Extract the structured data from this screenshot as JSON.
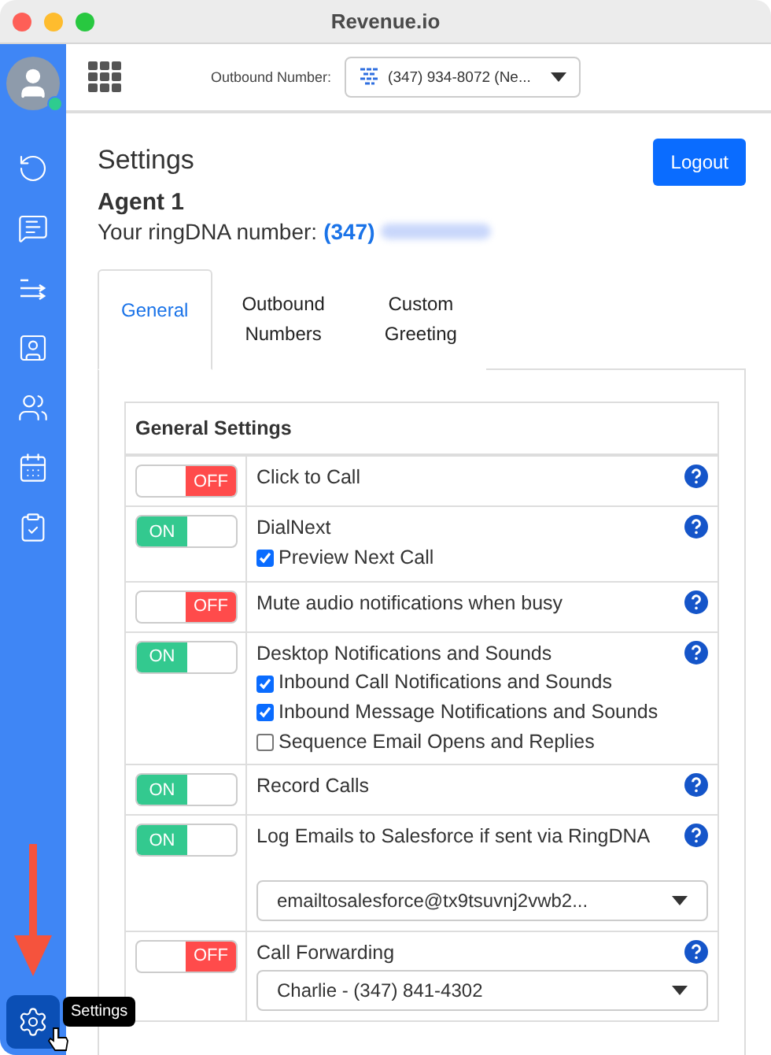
{
  "window": {
    "title": "Revenue.io"
  },
  "sidebar": {
    "user_online": true,
    "items": [
      {
        "kind": "refresh",
        "selected": false
      },
      {
        "kind": "chat",
        "selected": false
      },
      {
        "kind": "transfer",
        "selected": false
      },
      {
        "kind": "contact",
        "selected": false
      },
      {
        "kind": "people",
        "selected": false
      },
      {
        "kind": "calendar",
        "selected": false
      },
      {
        "kind": "tasks",
        "selected": false
      }
    ],
    "settings": {
      "kind": "settings",
      "selected": true
    },
    "tooltip": "Settings"
  },
  "topbar": {
    "outbound_label": "Outbound Number:",
    "outbound_value": "(347) 934-8072 (Ne..."
  },
  "page": {
    "title": "Settings",
    "logout": "Logout",
    "agent": "Agent 1",
    "number_label": "Your ringDNA number:",
    "number_value": "(347)"
  },
  "tabs": [
    {
      "label": "General",
      "selected": true
    },
    {
      "label": "Outbound\nNumbers",
      "selected": false
    },
    {
      "label": "Custom\nGreeting",
      "selected": false
    }
  ],
  "table": {
    "heading": "General Settings",
    "rows": [
      {
        "on": false,
        "state_text": "OFF",
        "label": "Click to Call",
        "options": []
      },
      {
        "on": true,
        "state_text": "ON",
        "label": "DialNext",
        "options": [
          {
            "label": "Preview Next Call",
            "checked": true
          }
        ]
      },
      {
        "on": false,
        "state_text": "OFF",
        "label": "Mute audio notifications when busy",
        "options": []
      },
      {
        "on": true,
        "state_text": "ON",
        "label": "Desktop Notifications and Sounds",
        "options": [
          {
            "label": "Inbound Call Notifications and Sounds",
            "checked": true
          },
          {
            "label": "Inbound Message Notifications and Sounds",
            "checked": true
          },
          {
            "label": "Sequence Email Opens and Replies",
            "checked": false
          }
        ]
      },
      {
        "on": true,
        "state_text": "ON",
        "label": "Record Calls",
        "options": []
      },
      {
        "on": true,
        "state_text": "ON",
        "label": "Log Emails to Salesforce if sent via RingDNA",
        "options": [],
        "select": "emailtosalesforce@tx9tsuvnj2vwb2..."
      },
      {
        "on": false,
        "state_text": "OFF",
        "label": "Call Forwarding",
        "options": [],
        "select": "Charlie - (347) 841-4302"
      }
    ]
  }
}
